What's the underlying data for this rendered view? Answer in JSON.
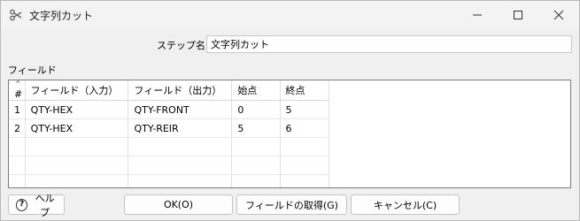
{
  "window": {
    "title": "文字列カット",
    "app_icon": "scissors-icon"
  },
  "form": {
    "step_name_label": "ステップ名",
    "step_name_value": "文字列カット"
  },
  "fields": {
    "label": "フィールド",
    "headers": [
      "#",
      "フィールド（入力）",
      "フィールド（出力）",
      "始点",
      "終点"
    ],
    "rows": [
      [
        "1",
        "QTY-HEX",
        "QTY-FRONT",
        "0",
        "5"
      ],
      [
        "2",
        "QTY-HEX",
        "QTY-REIR",
        "5",
        "6"
      ]
    ]
  },
  "buttons": {
    "help": "ヘルプ",
    "ok": "OK(O)",
    "get_fields": "フィールドの取得(G)",
    "cancel": "キャンセル(C)"
  }
}
